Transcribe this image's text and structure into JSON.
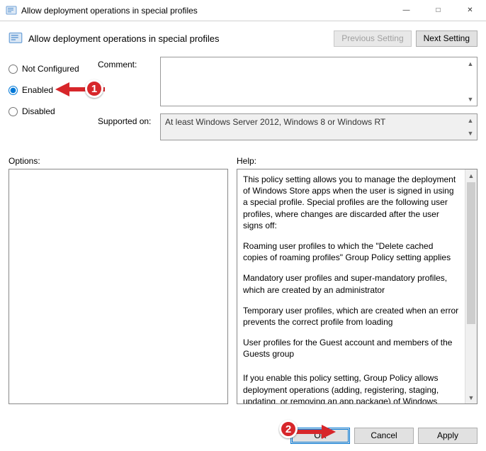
{
  "window": {
    "title": "Allow deployment operations in special profiles"
  },
  "header": {
    "title": "Allow deployment operations in special profiles",
    "prev": "Previous Setting",
    "next": "Next Setting"
  },
  "radios": {
    "not_configured": "Not Configured",
    "enabled": "Enabled",
    "disabled": "Disabled",
    "selected": "enabled"
  },
  "meta": {
    "comment_label": "Comment:",
    "comment_value": "",
    "supported_label": "Supported on:",
    "supported_value": "At least Windows Server 2012, Windows 8 or Windows RT"
  },
  "labels": {
    "options": "Options:",
    "help": "Help:"
  },
  "help_text": {
    "p1": "This policy setting allows you to manage the deployment of Windows Store apps when the user is signed in using a special profile. Special profiles are the following user profiles, where changes are discarded after the user signs off:",
    "p2": "Roaming user profiles to which the \"Delete cached copies of roaming profiles\" Group Policy setting applies",
    "p3": "Mandatory user profiles and super-mandatory profiles, which are created by an administrator",
    "p4": "Temporary user profiles, which are created when an error prevents the correct profile from loading",
    "p5": "User profiles for the Guest account and members of the Guests group",
    "p6": "If you enable this policy setting, Group Policy allows deployment operations (adding, registering, staging, updating, or removing an app package) of Windows Store apps when using a special"
  },
  "footer": {
    "ok": "OK",
    "cancel": "Cancel",
    "apply": "Apply"
  },
  "annotations": {
    "badge1": "1",
    "badge2": "2"
  }
}
